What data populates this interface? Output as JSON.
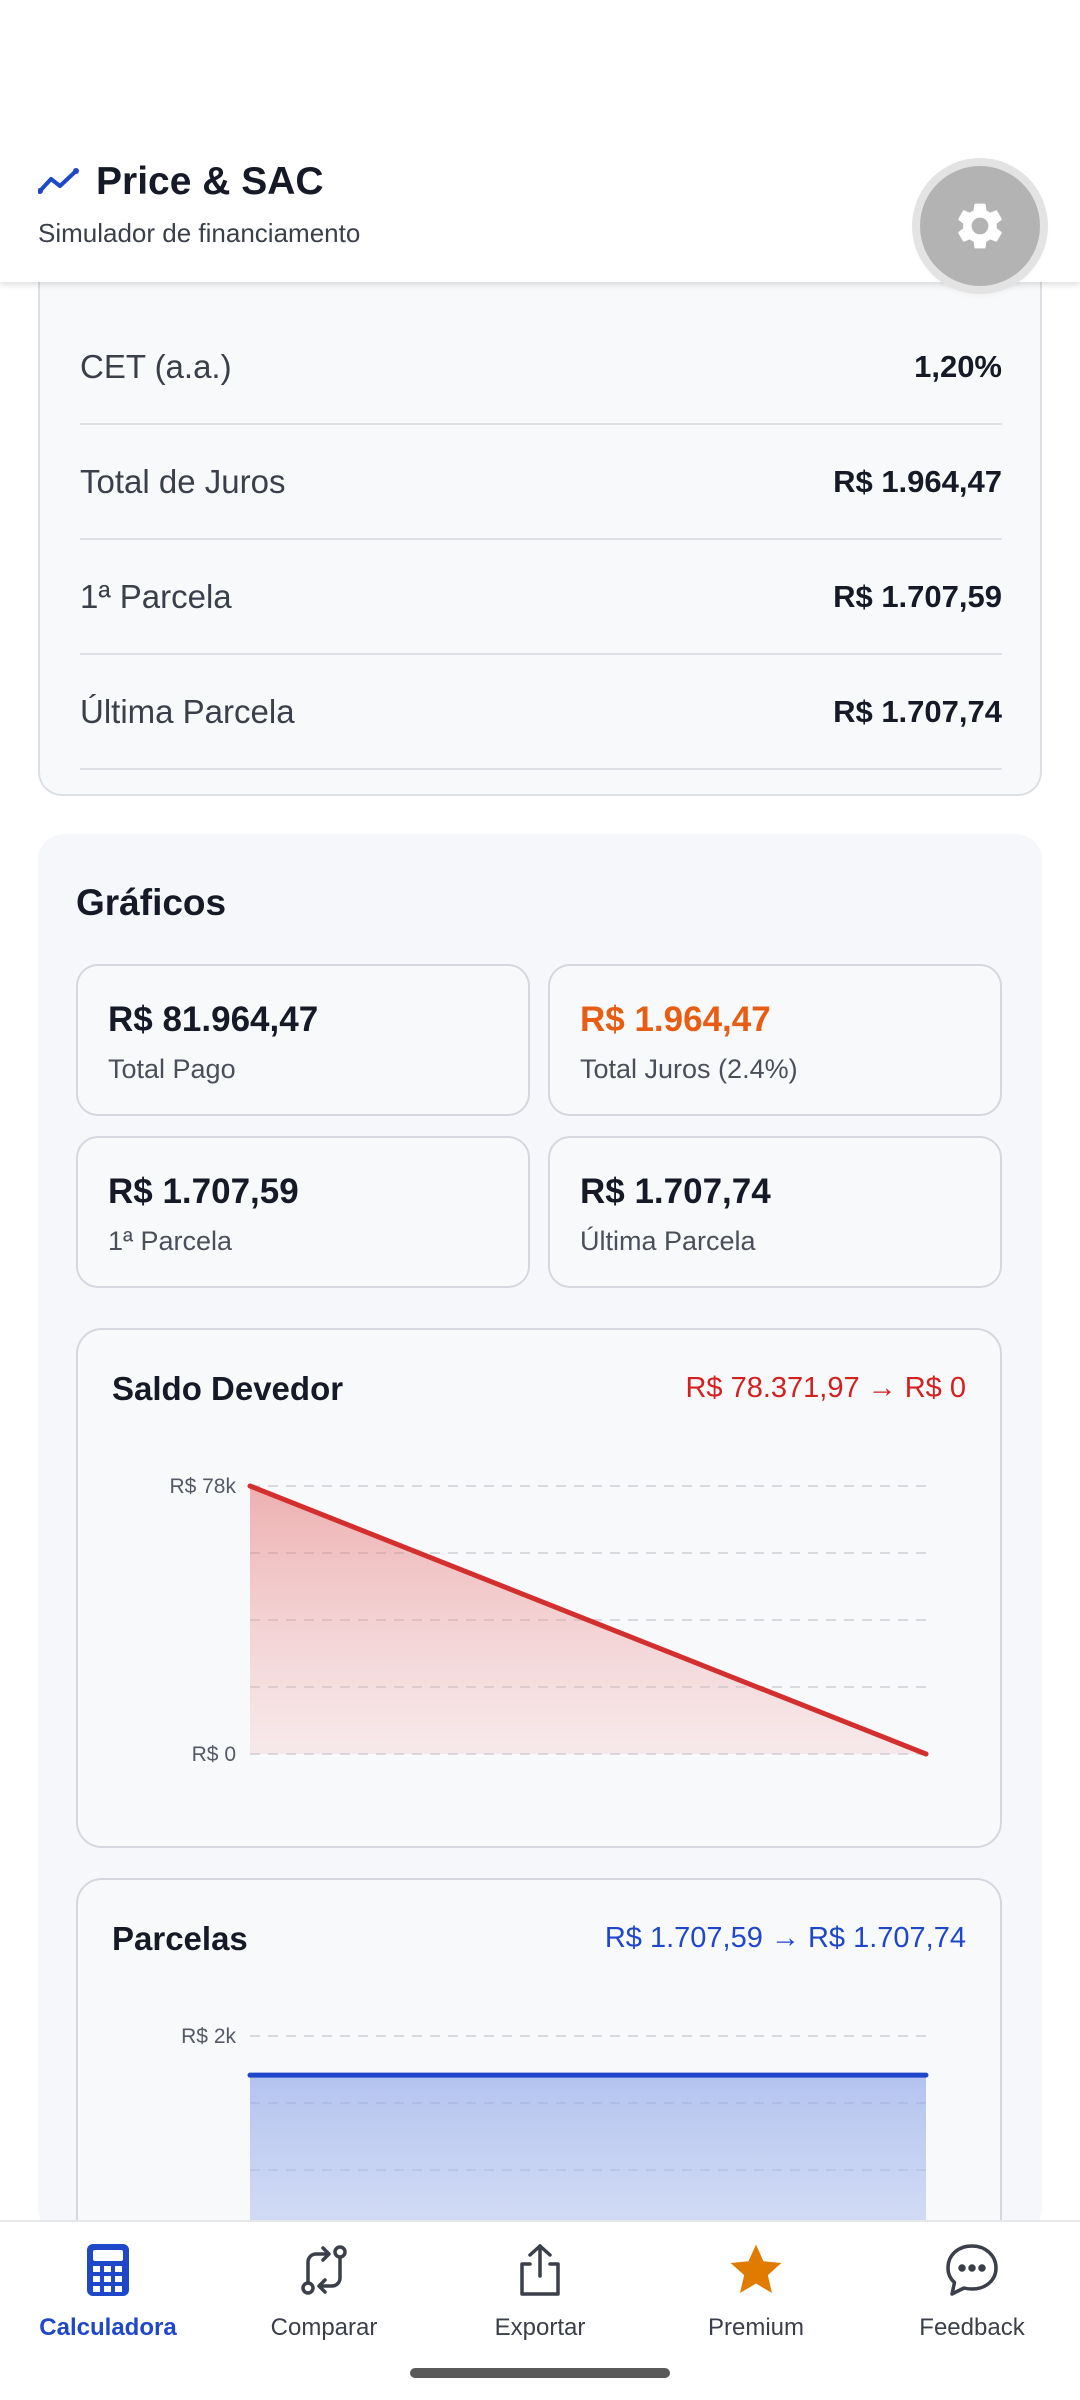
{
  "header": {
    "title": "Price & SAC",
    "subtitle": "Simulador de financiamento"
  },
  "summary": {
    "rows": [
      {
        "label": "CET (a.a.)",
        "value": "1,20%"
      },
      {
        "label": "Total de Juros",
        "value": "R$ 1.964,47"
      },
      {
        "label": "1ª Parcela",
        "value": "R$ 1.707,59"
      },
      {
        "label": "Última Parcela",
        "value": "R$ 1.707,74"
      }
    ]
  },
  "charts": {
    "title": "Gráficos",
    "stats": [
      {
        "value": "R$ 81.964,47",
        "label": "Total Pago"
      },
      {
        "value": "R$ 1.964,47",
        "label": "Total Juros (2.4%)"
      },
      {
        "value": "R$ 1.707,59",
        "label": "1ª Parcela"
      },
      {
        "value": "R$ 1.707,74",
        "label": "Última Parcela"
      }
    ],
    "balance_card": {
      "title": "Saldo Devedor",
      "range": "R$ 78.371,97 → R$ 0"
    },
    "installments_card": {
      "title": "Parcelas",
      "range": "R$ 1.707,59 → R$ 1.707,74"
    }
  },
  "chart_data": [
    {
      "type": "area",
      "title": "Saldo Devedor",
      "ytick_labels": [
        "R$ 78k",
        "R$ 0"
      ],
      "ylim": [
        0,
        78371.97
      ],
      "series": [
        {
          "values": [
            78371.97,
            0
          ]
        }
      ],
      "color": "#d32f2f",
      "grid": true
    },
    {
      "type": "area",
      "title": "Parcelas",
      "ytick_labels": [
        "R$ 2k"
      ],
      "ylim": [
        0,
        2000
      ],
      "series": [
        {
          "values": [
            1707.59,
            1707.74
          ]
        }
      ],
      "color": "#1f47c9",
      "grid": true
    }
  ],
  "nav": {
    "items": [
      {
        "label": "Calculadora",
        "icon": "calculator-icon",
        "active": true
      },
      {
        "label": "Comparar",
        "icon": "compare-icon",
        "active": false
      },
      {
        "label": "Exportar",
        "icon": "share-icon",
        "active": false
      },
      {
        "label": "Premium",
        "icon": "star-icon",
        "active": false
      },
      {
        "label": "Feedback",
        "icon": "chat-bubble-icon",
        "active": false
      }
    ]
  },
  "colors": {
    "accent": "#1f47c9",
    "danger": "#d32020",
    "warning": "#e85d14",
    "premium": "#e07b00"
  }
}
